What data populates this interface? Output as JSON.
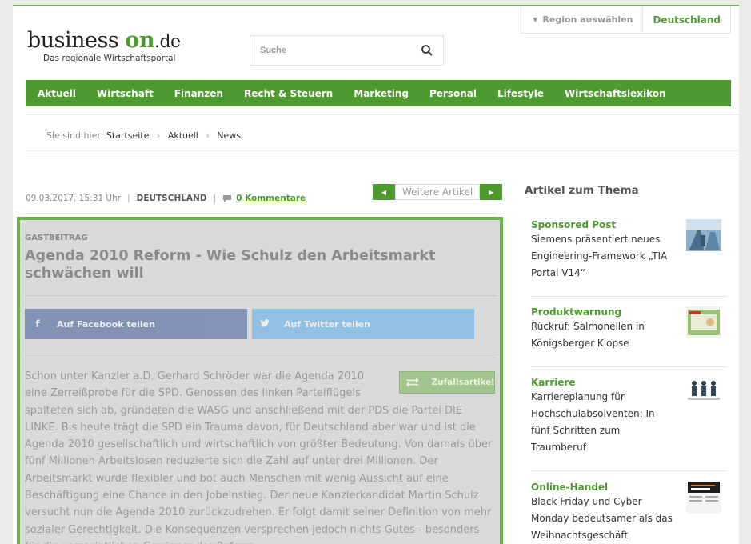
{
  "header": {
    "region_select_label": "Region auswählen",
    "region_current": "Deutschland",
    "logo_text_start": "business",
    "logo_text_on": "on",
    "logo_text_tld": ".de",
    "logo_tagline": "Das regionale Wirtschaftsportal",
    "search_placeholder": "Suche"
  },
  "nav": {
    "items": [
      "Aktuell",
      "Wirtschaft",
      "Finanzen",
      "Recht & Steuern",
      "Marketing",
      "Personal",
      "Lifestyle",
      "Wirtschaftslexikon"
    ]
  },
  "breadcrumb": {
    "prefix": "Sie sind hier:",
    "items": [
      "Startseite",
      "Aktuell",
      "News"
    ]
  },
  "article": {
    "date": "09.03.2017, 15:31 Uhr",
    "region": "DEUTSCHLAND",
    "comments": "0 Kommentare",
    "pager_label": "Weitere Artikel",
    "kicker": "GASTBEITRAG",
    "headline": "Agenda 2010 Reform - Wie Schulz den Arbeitsmarkt schwächen will",
    "share_facebook": "Auf Facebook teilen",
    "share_twitter": "Auf Twitter teilen",
    "random_label": "Zufallsartikel",
    "body": "Schon unter Kanzler a.D. Gerhard Schröder war die Agenda 2010 eine Zerreißprobe für die SPD. Genossen des linken Parteiflügels spalteten sich ab, gründeten die WASG und anschließend mit der PDS die Partei DIE LINKE. Bis heute trägt die SPD ein Trauma davon, für Deutschland aber war und ist die Agenda 2010 gesellschaftlich und wirtschaftlich von größter Bedeutung. Von damals über fünf Millionen Arbeitslosen reduzierte sich die Zahl auf unter drei Millionen. Der Arbeitsmarkt wurde flexibler und bot auch Menschen mit wenig Aussicht auf eine Beschäftigung eine Chance in den Jobeinstieg. Der neue Kanzlerkandidat Martin Schulz versucht nun die Agenda 2010 zurückzudrehen. Er folgt damit seiner Definition von mehr sozialer Gerechtigkeit. Die Konsequenzen versprechen jedoch nichts Gutes - besonders für die vermeintlichen Gewinner der Reform."
  },
  "sidebar": {
    "title": "Artikel zum Thema",
    "items": [
      {
        "category": "Sponsored Post",
        "text": "Siemens präsentiert neues Engineering-Framework „TIA Portal V14“"
      },
      {
        "category": "Produktwarnung",
        "text": "Rückruf: Salmonellen in Königsberger Klopse"
      },
      {
        "category": "Karriere",
        "text": "Karriereplanung für Hochschulabsolventen: In fünf Schritten zum Traumberuf"
      },
      {
        "category": "Online-Handel",
        "text": "Black Friday und Cyber Monday bedeutsamer als das Weihnachtsgeschäft"
      }
    ]
  },
  "colors": {
    "brand_green": "#4e9a31",
    "card_border": "#6ab04c",
    "facebook": "#3b5998",
    "twitter": "#55acee"
  }
}
